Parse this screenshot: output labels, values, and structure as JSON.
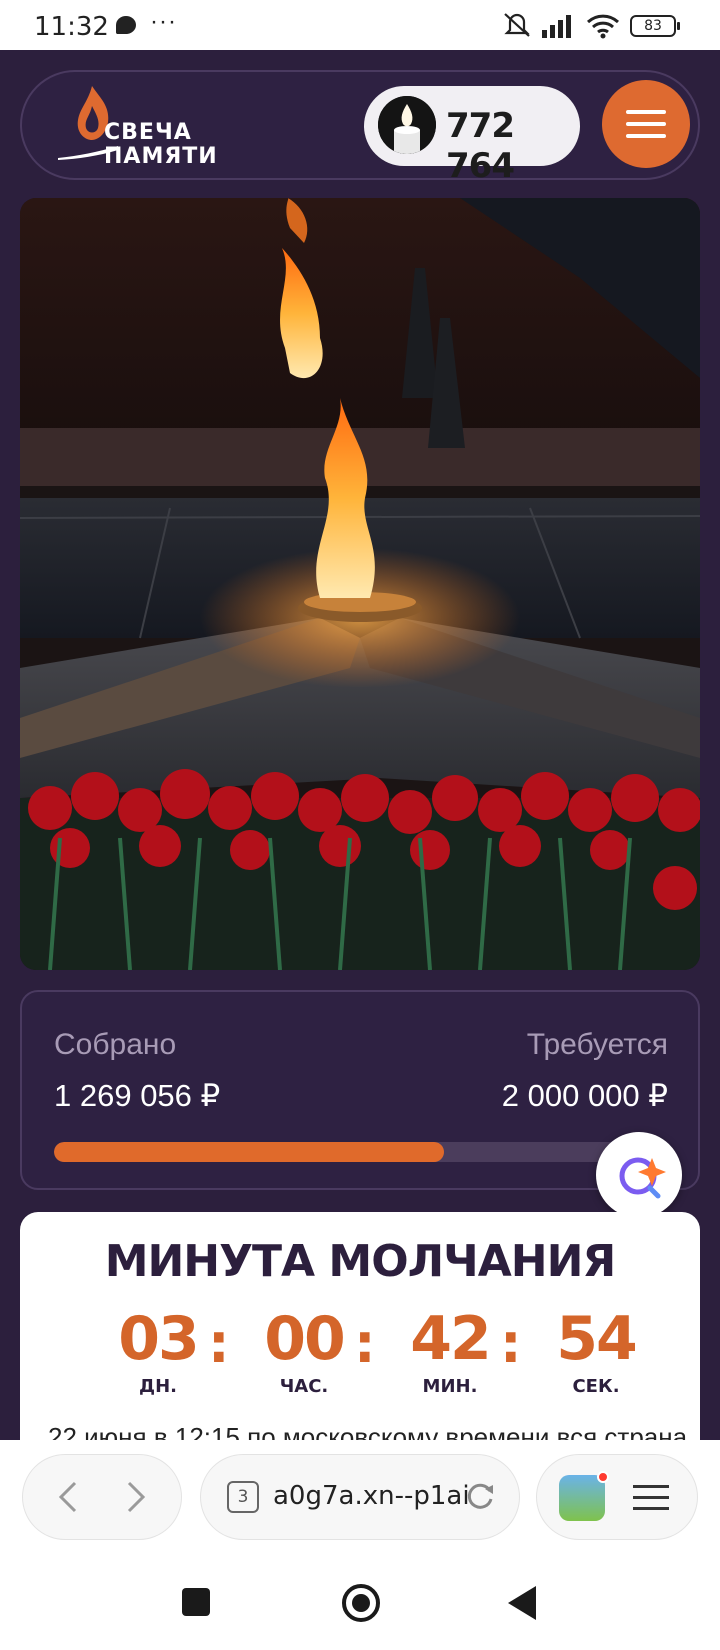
{
  "status_bar": {
    "time": "11:32",
    "more": "···",
    "battery": "83",
    "icons": [
      "chat-bubble-icon",
      "mute-icon",
      "signal-icon",
      "wifi-icon",
      "battery-icon"
    ]
  },
  "header": {
    "logo_line1": "СВЕЧА",
    "logo_line2": "ПАМЯТИ",
    "candle_count": "772 764",
    "menu_icon": "hamburger-menu-icon",
    "brand_color": "#de6a30",
    "background_color": "#2c1f3d"
  },
  "hero": {
    "icon": "eternal-flame-photo"
  },
  "funds": {
    "collected_label": "Собрано",
    "collected_value": "1 269 056 ₽",
    "required_label": "Требуется",
    "required_value": "2 000 000 ₽",
    "progress": 0.6345,
    "progress_color": "#e06a2b"
  },
  "countdown": {
    "title": "МИНУТА МОЛЧАНИЯ",
    "days": "03",
    "days_label": "ДН.",
    "hours": "00",
    "hours_label": "ЧАС.",
    "minutes": "42",
    "minutes_label": "МИН.",
    "seconds": "54",
    "seconds_label": "СЕК.",
    "separator": ":",
    "text": "22 июня в 12:15 по московскому времени вся страна"
  },
  "browser": {
    "tab_count": "3",
    "url": "a0g7a.xn--p1ai",
    "icons": [
      "back-arrow-icon",
      "forward-arrow-icon",
      "reload-icon",
      "game-app-icon",
      "browser-menu-icon"
    ]
  },
  "system_nav": {
    "icons": [
      "recents-icon",
      "home-icon",
      "back-icon"
    ]
  }
}
